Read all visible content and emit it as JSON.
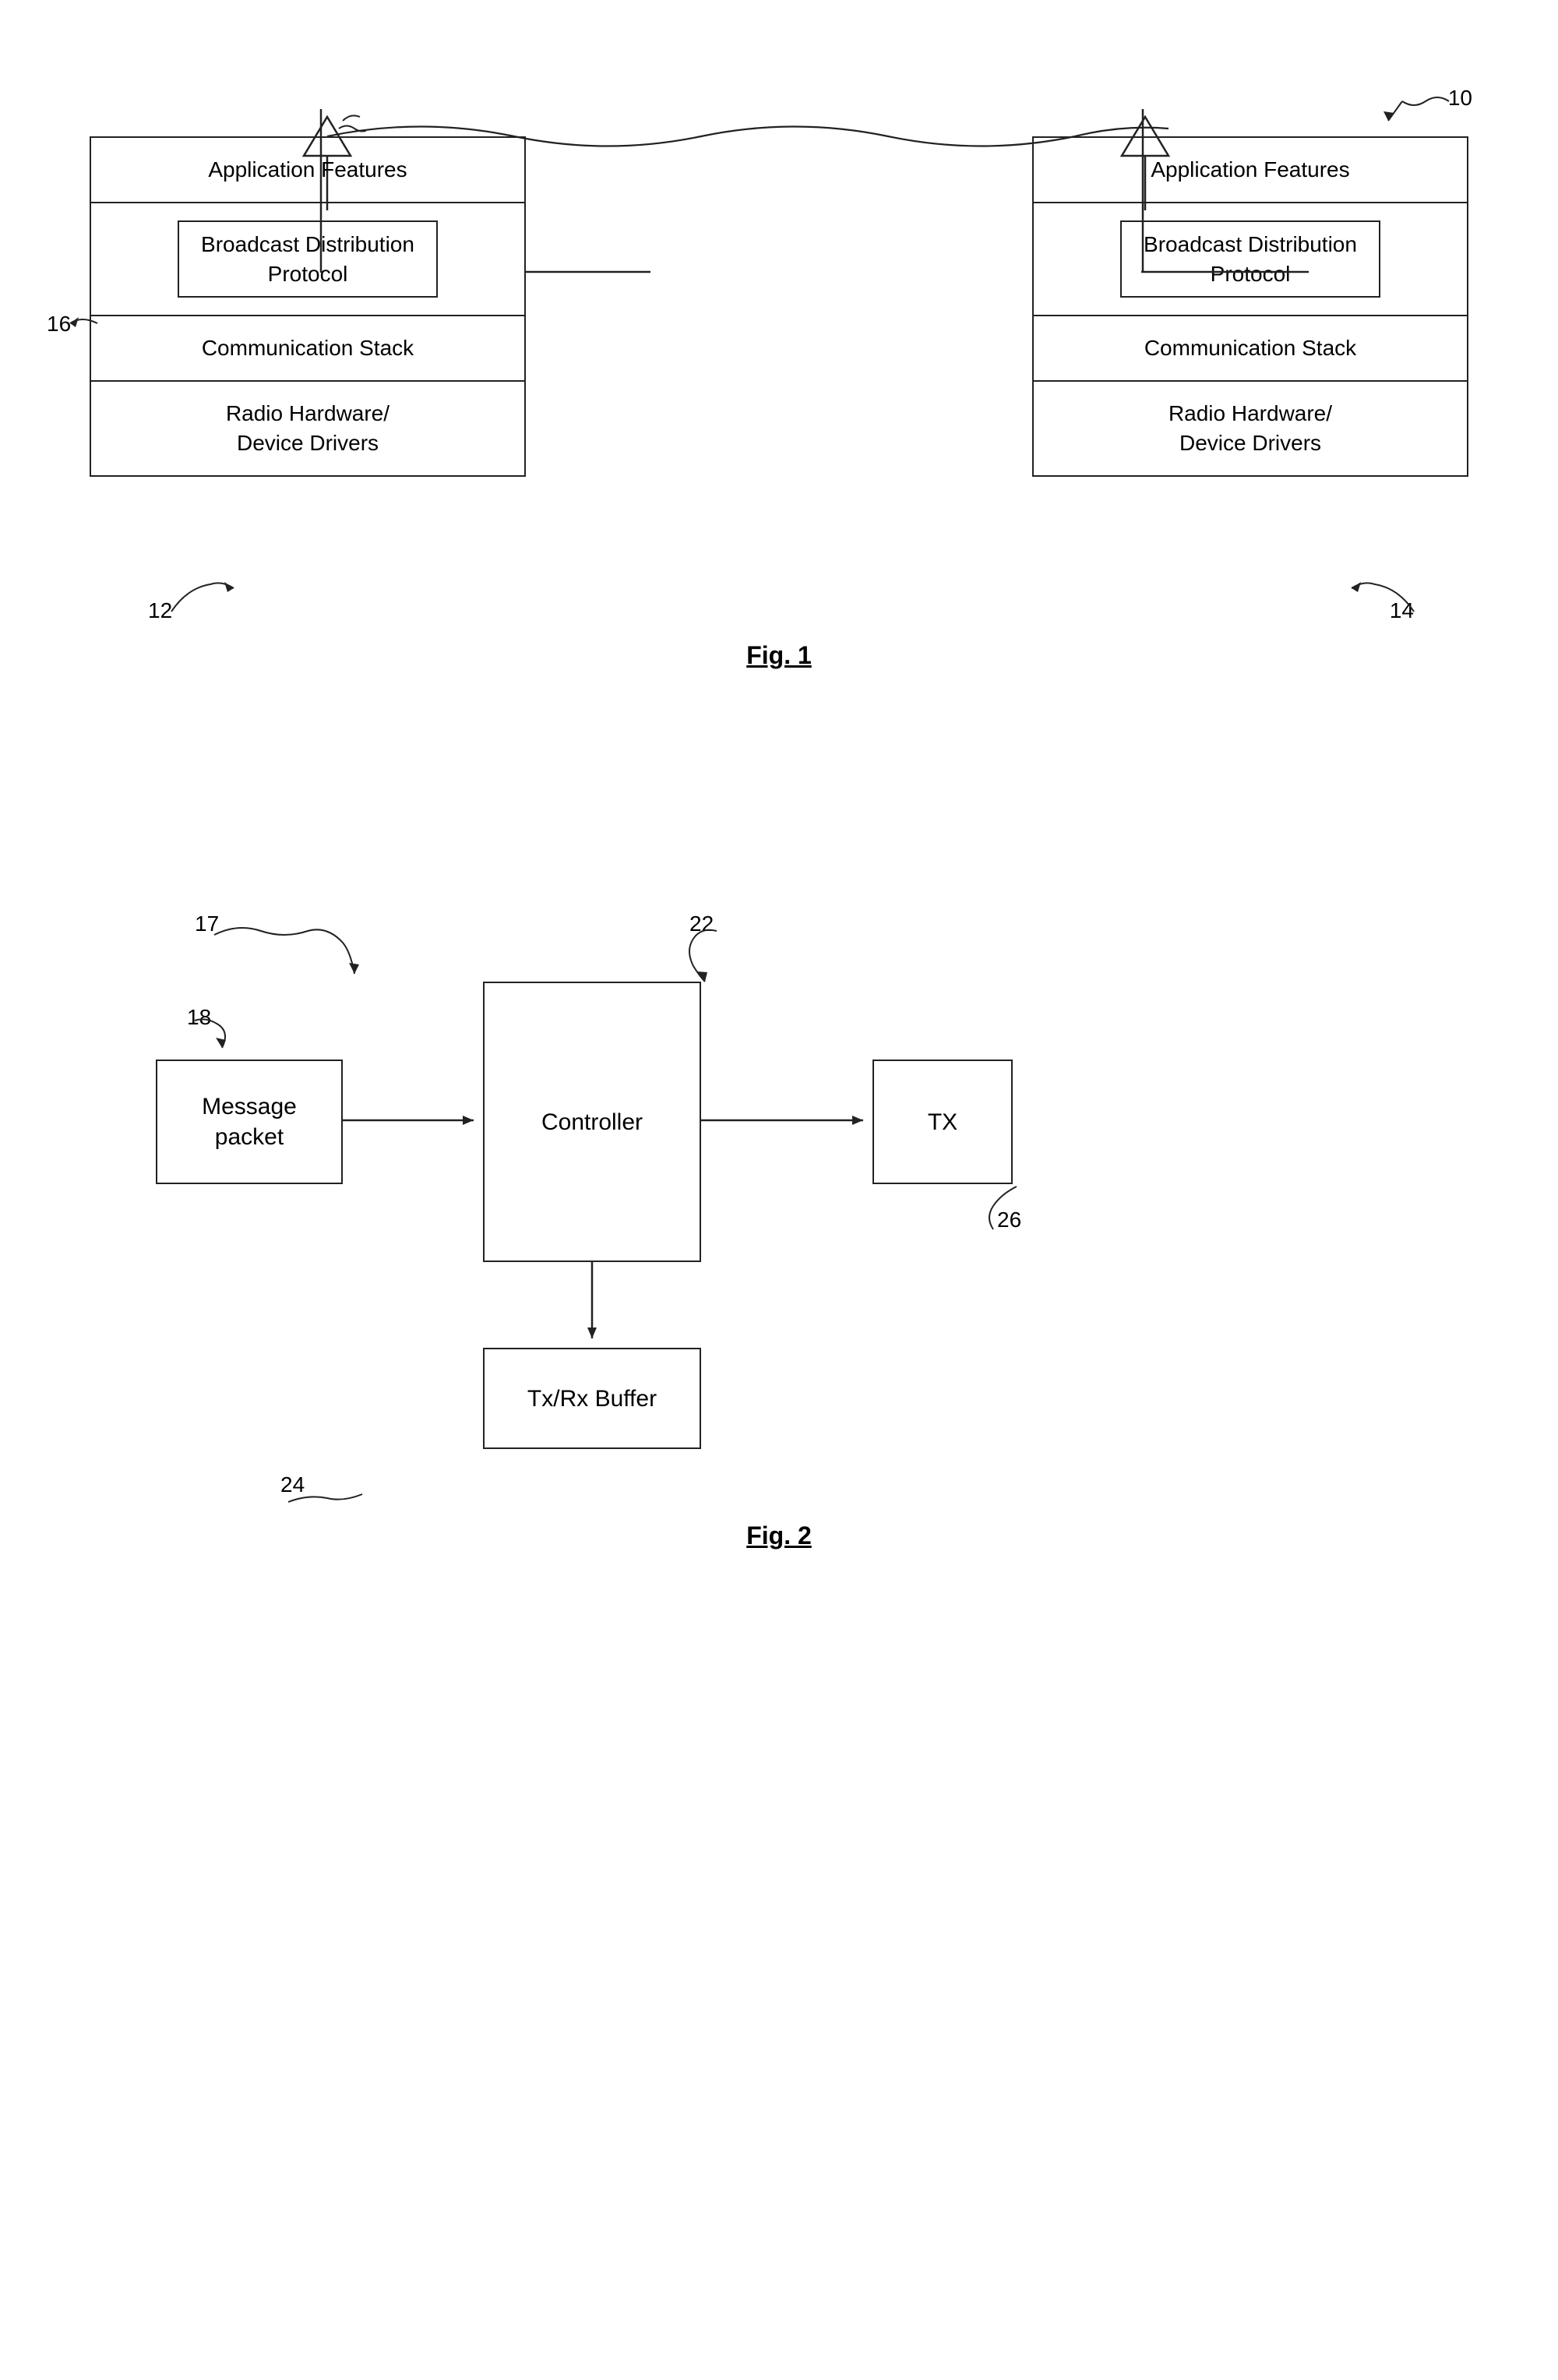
{
  "fig1": {
    "ref_10": "10",
    "ref_12": "12",
    "ref_14": "14",
    "ref_16": "16",
    "caption": "Fig. 1",
    "left_device": {
      "layers": [
        {
          "id": "app-features-left",
          "text": "Application Features",
          "type": "plain"
        },
        {
          "id": "bdp-left",
          "text": "Broadcast Distribution\nProtocol",
          "type": "inner-box"
        },
        {
          "id": "comm-stack-left",
          "text": "Communication Stack",
          "type": "plain"
        },
        {
          "id": "radio-left",
          "text": "Radio Hardware/\nDevice Drivers",
          "type": "plain"
        }
      ]
    },
    "right_device": {
      "layers": [
        {
          "id": "app-features-right",
          "text": "Application Features",
          "type": "plain"
        },
        {
          "id": "bdp-right",
          "text": "Broadcast Distribution\nProtocol",
          "type": "inner-box"
        },
        {
          "id": "comm-stack-right",
          "text": "Communication Stack",
          "type": "plain"
        },
        {
          "id": "radio-right",
          "text": "Radio Hardware/\nDevice Drivers",
          "type": "plain"
        }
      ]
    }
  },
  "fig2": {
    "caption": "Fig. 2",
    "ref_17": "17",
    "ref_18": "18",
    "ref_22": "22",
    "ref_24": "24",
    "ref_26": "26",
    "message_packet": "Message\npacket",
    "controller": "Controller",
    "tx": "TX",
    "tx_rx_buffer": "Tx/Rx Buffer"
  }
}
